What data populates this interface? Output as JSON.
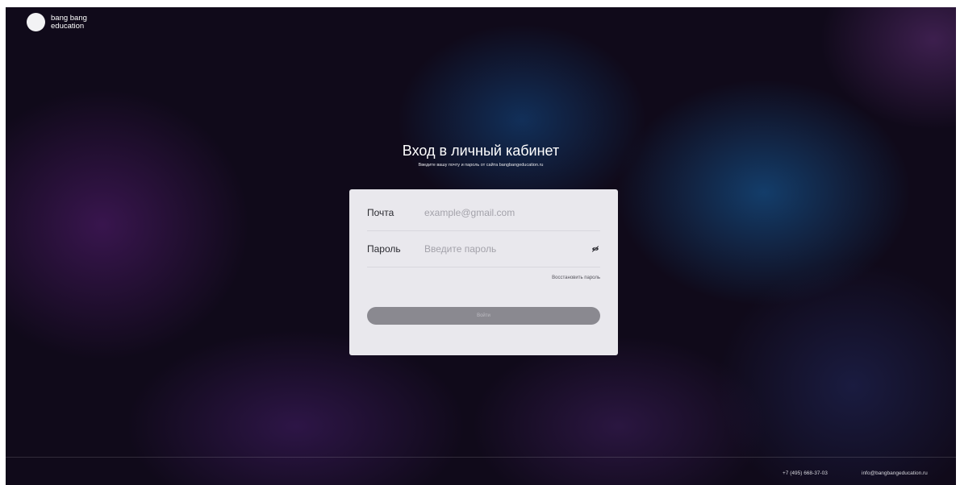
{
  "brand": {
    "line1": "bang bang",
    "line2": "education"
  },
  "login": {
    "title": "Вход в личный кабинет",
    "subtitle": "Введите вашу почту и пароль от сайта bangbangeducation.ru",
    "email_label": "Почта",
    "email_placeholder": "example@gmail.com",
    "email_value": "",
    "password_label": "Пароль",
    "password_placeholder": "Введите пароль",
    "password_value": "",
    "password_toggle_icon": "eye-icon",
    "restore_link": "Восстановить пароль",
    "submit_label": "Войти"
  },
  "footer": {
    "phone": "+7 (495) 668-37-03",
    "email": "info@bangbangeducation.ru"
  },
  "colors": {
    "card_background": "#e9e8ed",
    "button_disabled": "#8a8990",
    "page_background": "#100a1a"
  }
}
